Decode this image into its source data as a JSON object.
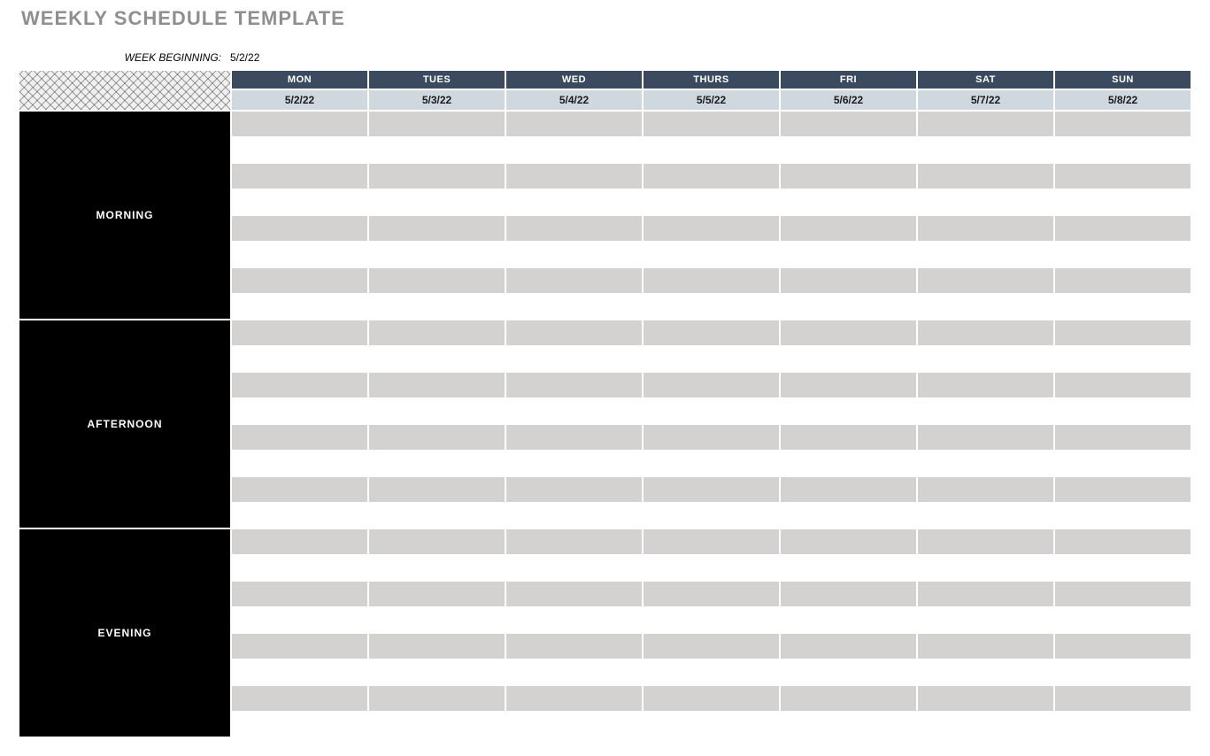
{
  "title": "WEEKLY SCHEDULE TEMPLATE",
  "week_begin_label": "WEEK BEGINNING:",
  "week_begin_value": "5/2/22",
  "days": [
    {
      "name": "MON",
      "date": "5/2/22"
    },
    {
      "name": "TUES",
      "date": "5/3/22"
    },
    {
      "name": "WED",
      "date": "5/4/22"
    },
    {
      "name": "THURS",
      "date": "5/5/22"
    },
    {
      "name": "FRI",
      "date": "5/6/22"
    },
    {
      "name": "SAT",
      "date": "5/7/22"
    },
    {
      "name": "SUN",
      "date": "5/8/22"
    }
  ],
  "periods": [
    {
      "name": "MORNING",
      "slots": [
        [
          "",
          "",
          "",
          "",
          "",
          "",
          ""
        ],
        [
          "",
          "",
          "",
          "",
          "",
          "",
          ""
        ],
        [
          "",
          "",
          "",
          "",
          "",
          "",
          ""
        ],
        [
          "",
          "",
          "",
          "",
          "",
          "",
          ""
        ],
        [
          "",
          "",
          "",
          "",
          "",
          "",
          ""
        ],
        [
          "",
          "",
          "",
          "",
          "",
          "",
          ""
        ],
        [
          "",
          "",
          "",
          "",
          "",
          "",
          ""
        ],
        [
          "",
          "",
          "",
          "",
          "",
          "",
          ""
        ]
      ]
    },
    {
      "name": "AFTERNOON",
      "slots": [
        [
          "",
          "",
          "",
          "",
          "",
          "",
          ""
        ],
        [
          "",
          "",
          "",
          "",
          "",
          "",
          ""
        ],
        [
          "",
          "",
          "",
          "",
          "",
          "",
          ""
        ],
        [
          "",
          "",
          "",
          "",
          "",
          "",
          ""
        ],
        [
          "",
          "",
          "",
          "",
          "",
          "",
          ""
        ],
        [
          "",
          "",
          "",
          "",
          "",
          "",
          ""
        ],
        [
          "",
          "",
          "",
          "",
          "",
          "",
          ""
        ],
        [
          "",
          "",
          "",
          "",
          "",
          "",
          ""
        ]
      ]
    },
    {
      "name": "EVENING",
      "slots": [
        [
          "",
          "",
          "",
          "",
          "",
          "",
          ""
        ],
        [
          "",
          "",
          "",
          "",
          "",
          "",
          ""
        ],
        [
          "",
          "",
          "",
          "",
          "",
          "",
          ""
        ],
        [
          "",
          "",
          "",
          "",
          "",
          "",
          ""
        ],
        [
          "",
          "",
          "",
          "",
          "",
          "",
          ""
        ],
        [
          "",
          "",
          "",
          "",
          "",
          "",
          ""
        ],
        [
          "",
          "",
          "",
          "",
          "",
          "",
          ""
        ],
        [
          "",
          "",
          "",
          "",
          "",
          "",
          ""
        ]
      ]
    }
  ]
}
